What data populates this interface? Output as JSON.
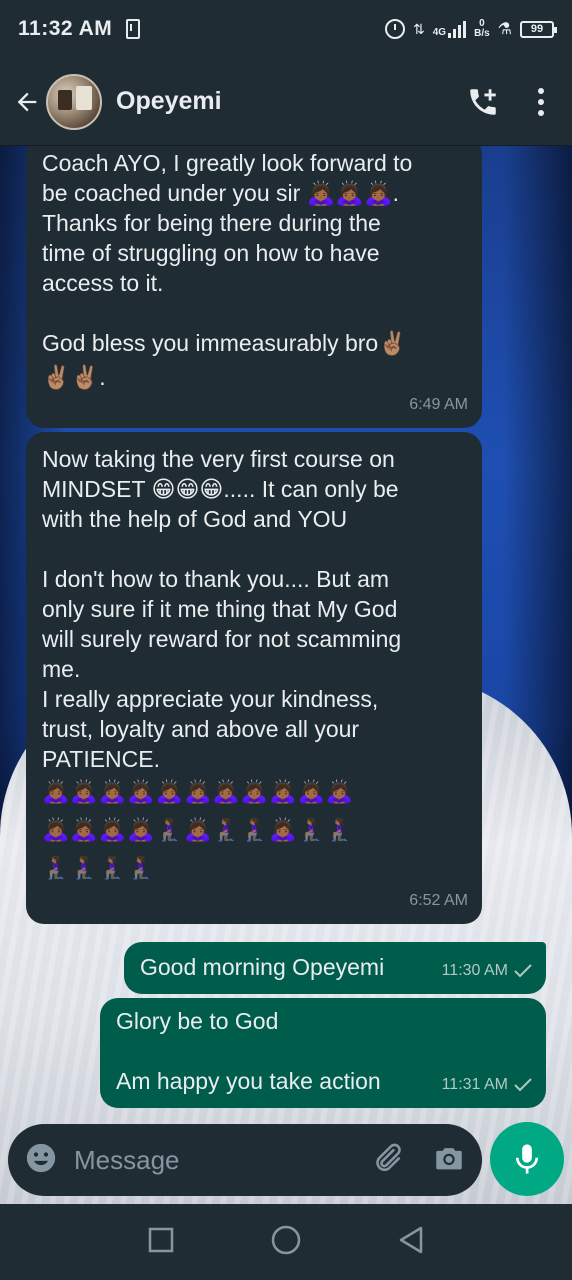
{
  "status_bar": {
    "time": "11:32 AM",
    "network_type": "4G",
    "data_speed_value": "0",
    "data_speed_unit": "B/s",
    "battery": "99"
  },
  "header": {
    "contact_name": "Opeyemi"
  },
  "messages": [
    {
      "direction": "incoming",
      "lines": [
        "Coach AYO, I greatly look forward to",
        "be coached under you sir 🙇🏾‍♀️🙇🏾‍♀️🙇🏾‍♀️.",
        "Thanks for being there during the",
        "time of struggling on how to have",
        "access to it.",
        "",
        "God bless you immeasurably bro✌🏽",
        "✌🏽✌🏽."
      ],
      "time": "6:49 AM"
    },
    {
      "direction": "incoming",
      "lines": [
        "Now taking the very first course on",
        "MINDSET 😁😁😁..... It can only be",
        "with the help of God and YOU",
        "",
        "I don't how to thank you.... But am",
        "only sure if it me thing that My God",
        "will surely reward for not scamming",
        "me.",
        "I really appreciate your kindness,",
        "trust, loyalty and above all your",
        "PATIENCE."
      ],
      "emoji_rows": [
        "🙇🏾‍♀️🙇🏾‍♀️🙇🏾‍♀️🙇🏾‍♀️🙇🏾‍♀️🙇🏾‍♀️🙇🏾‍♀️🙇🏾‍♀️🙇🏾‍♀️🙇🏾‍♀️🙇🏾‍♀️",
        "🙇🏾‍♀️🙇🏾‍♀️🙇🏾‍♀️🙇🏾‍♀️🧎🏾‍♀️🙇🏾‍♀️🧎🏾‍♀️🧎🏾‍♀️🙇🏾‍♀️🧎🏾‍♀️🧎🏾‍♀️",
        "🧎🏾‍♀️🧎🏾‍♀️🧎🏾‍♀️🧎🏾‍♀️"
      ],
      "time": "6:52 AM"
    },
    {
      "direction": "outgoing",
      "lines": [
        "Good morning Opeyemi"
      ],
      "time": "11:30 AM"
    },
    {
      "direction": "outgoing",
      "lines": [
        "Glory be to God",
        "",
        "Am happy you take action"
      ],
      "time": "11:31 AM"
    }
  ],
  "composer": {
    "placeholder": "Message"
  },
  "icons": {
    "back": "back-arrow-icon",
    "call": "add-call-icon",
    "menu": "more-vert-icon",
    "emoji": "emoji-icon",
    "attach": "paperclip-icon",
    "camera": "camera-icon",
    "mic": "mic-icon",
    "read_receipt": "check-icon"
  },
  "colors": {
    "header_bg": "#1f2c34",
    "incoming_bubble": "#1f2c34",
    "outgoing_bubble": "#005c4b",
    "accent": "#00a884",
    "muted_text": "#8696a0"
  }
}
